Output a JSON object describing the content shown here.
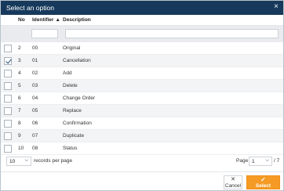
{
  "dialog": {
    "title": "Select an option",
    "close_icon": "×"
  },
  "columns": {
    "no": "No",
    "identifier": "Identifier",
    "description": "Description",
    "sort_indicator": "▲"
  },
  "filters": {
    "identifier": "",
    "description": ""
  },
  "rows": [
    {
      "no": "2",
      "identifier": "00",
      "description": "Original",
      "checked": false
    },
    {
      "no": "3",
      "identifier": "01",
      "description": "Cancellation",
      "checked": true
    },
    {
      "no": "4",
      "identifier": "02",
      "description": "Add",
      "checked": false
    },
    {
      "no": "5",
      "identifier": "03",
      "description": "Delete",
      "checked": false
    },
    {
      "no": "6",
      "identifier": "04",
      "description": "Change Order",
      "checked": false
    },
    {
      "no": "7",
      "identifier": "05",
      "description": "Replace",
      "checked": false
    },
    {
      "no": "8",
      "identifier": "06",
      "description": "Confirmation",
      "checked": false
    },
    {
      "no": "9",
      "identifier": "07",
      "description": "Duplicate",
      "checked": false
    },
    {
      "no": "10",
      "identifier": "08",
      "description": "Status",
      "checked": false
    }
  ],
  "pager": {
    "page_size": "10",
    "records_per_page": "records per page",
    "page_label": "Page",
    "page": "1",
    "total": "/ 7"
  },
  "footer": {
    "cancel_label": "Cancel",
    "select_label": "Select"
  },
  "colors": {
    "title_bar": "#173a5c",
    "select_button": "#f59a25"
  }
}
